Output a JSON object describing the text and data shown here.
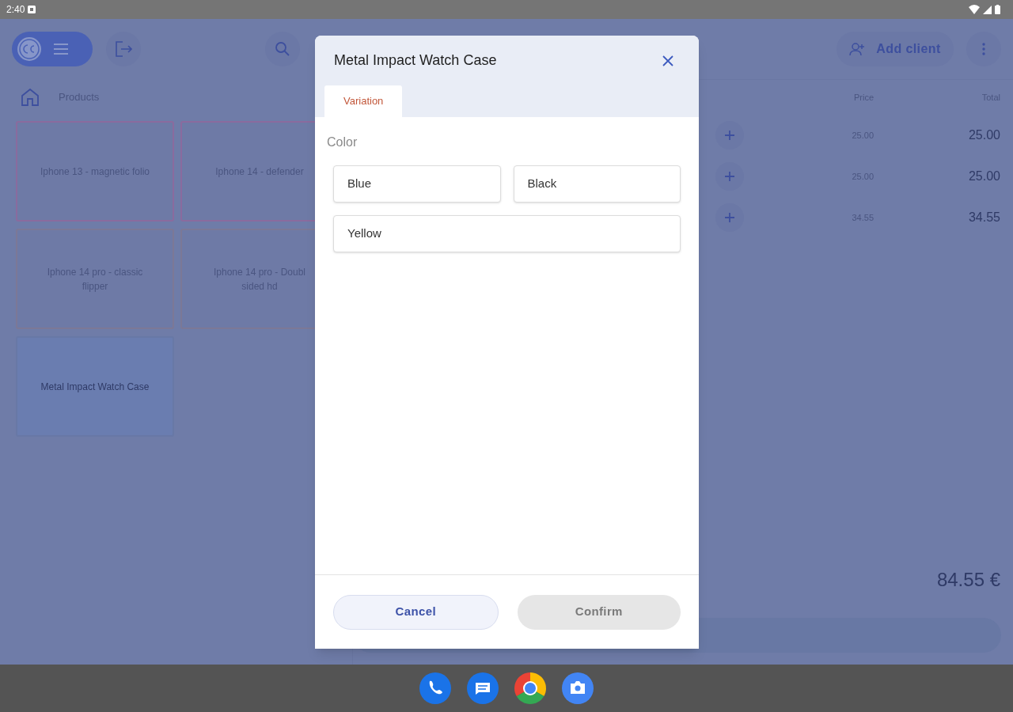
{
  "status_bar": {
    "time": "2:40"
  },
  "header": {
    "add_client": "Add client"
  },
  "breadcrumb": {
    "label": "Products"
  },
  "products": [
    {
      "name": "Iphone 13 - magnetic folio",
      "color": "#8a6b9e",
      "selected": false
    },
    {
      "name": "Iphone 14 - defender",
      "color": "#8a6b9e",
      "selected": false
    },
    {
      "name": "Iphone 14  pro - classic flipper",
      "color": "#7c7896",
      "selected": false
    },
    {
      "name": "Iphone 14 pro - Doubl\nsided hd",
      "color": "#7c7896",
      "selected": false
    },
    {
      "name": "Metal Impact Watch Case",
      "color": "#6878a6",
      "selected": true
    }
  ],
  "cart": {
    "columns": [
      "Price",
      "Total"
    ],
    "rows": [
      {
        "price": "25.00",
        "total": "25.00"
      },
      {
        "price": "25.00",
        "total": "25.00"
      },
      {
        "price": "34.55",
        "total": "34.55"
      }
    ],
    "grand_total": "84.55 €"
  },
  "dialog": {
    "title": "Metal Impact Watch Case",
    "tabs": [
      {
        "label": "Variation",
        "selected": true
      }
    ],
    "group_label": "Color",
    "options": [
      {
        "label": "Blue",
        "selected": false
      },
      {
        "label": "Black",
        "selected": false
      },
      {
        "label": "Yellow",
        "selected": false
      }
    ],
    "cancel": "Cancel",
    "confirm": {
      "label": "Confirm",
      "disabled": true
    }
  }
}
